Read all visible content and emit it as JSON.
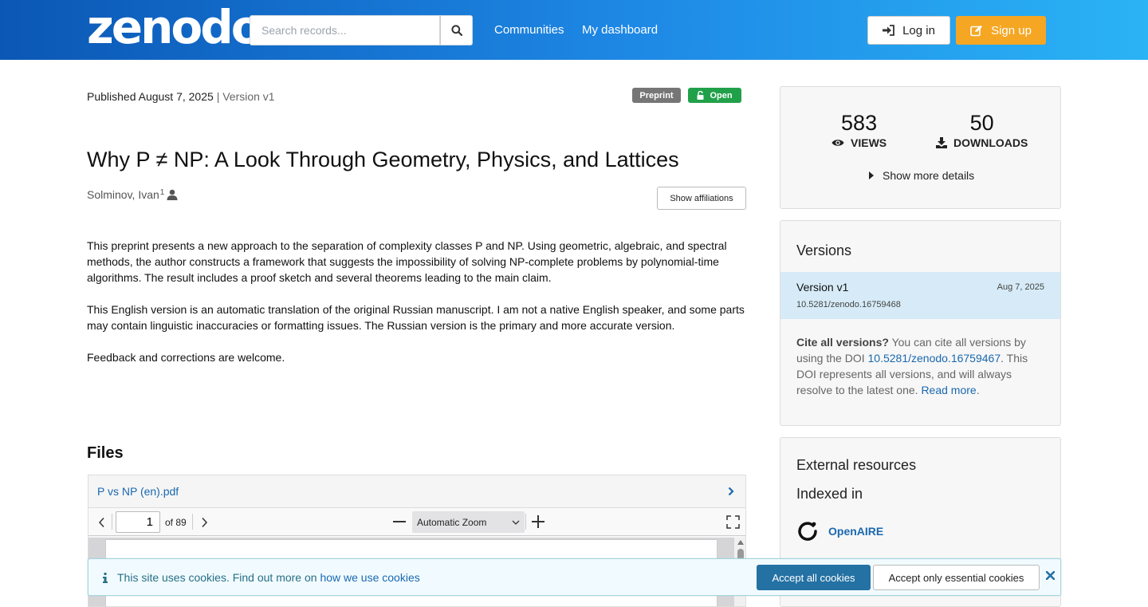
{
  "header": {
    "logo": "zenodo",
    "search_placeholder": "Search records...",
    "nav": [
      "Communities",
      "My dashboard"
    ],
    "login_label": "Log in",
    "signup_label": "Sign up"
  },
  "record": {
    "published": "Published August 7, 2025",
    "separator": "|",
    "version": "Version v1",
    "badge_type": "Preprint",
    "badge_access": "Open",
    "title": "Why P ≠ NP: A Look Through Geometry, Physics, and Lattices",
    "creator": "Solminov, Ivan",
    "creator_affil_index": "1",
    "show_affiliations": "Show affiliations",
    "description": [
      "This preprint presents a new approach to the separation of complexity classes P and NP. Using geometric, algebraic, and spectral methods, the author constructs a framework that suggests the impossibility of solving NP-complete problems by polynomial-time algorithms. The result includes a proof sketch and several theorems leading to the main claim.",
      "This English version is an automatic translation of the original Russian manuscript. I am not a native English speaker, and some parts may contain linguistic inaccuracies or formatting issues. The Russian version is the primary and more accurate version.",
      "Feedback and corrections are welcome."
    ]
  },
  "files": {
    "title": "Files",
    "file_name": "P vs NP (en).pdf",
    "current_page": "1",
    "page_count": "of 89",
    "zoom": "Automatic Zoom"
  },
  "stats": {
    "views": "583",
    "views_label": "VIEWS",
    "downloads": "50",
    "downloads_label": "DOWNLOADS",
    "more_details": "Show more details"
  },
  "versions": {
    "title": "Versions",
    "item_name": "Version v1",
    "item_date": "Aug 7, 2025",
    "item_doi": "10.5281/zenodo.16759468",
    "cite_bold": "Cite all versions?",
    "cite_text1": " You can cite all versions by using the DOI ",
    "cite_doi": "10.5281/zenodo.16759467",
    "cite_text2": ". This DOI represents all versions, and will always resolve to the latest one. ",
    "read_more": "Read more",
    "cite_end": "."
  },
  "external": {
    "title": "External resources",
    "indexed_in": "Indexed in",
    "openaire": "OpenAIRE"
  },
  "cookie": {
    "text": "This site uses cookies. Find out more on ",
    "link": "how we use cookies",
    "accept_all": "Accept all cookies",
    "accept_essential": "Accept only essential cookies"
  },
  "colors": {
    "header_start": "#0b57b5",
    "header_end": "#2ab3f5",
    "signup": "#f5a623",
    "open_badge": "#21a04a",
    "preprint_badge": "#767676",
    "link": "#1a68b0",
    "accept_all": "#2471a3"
  }
}
